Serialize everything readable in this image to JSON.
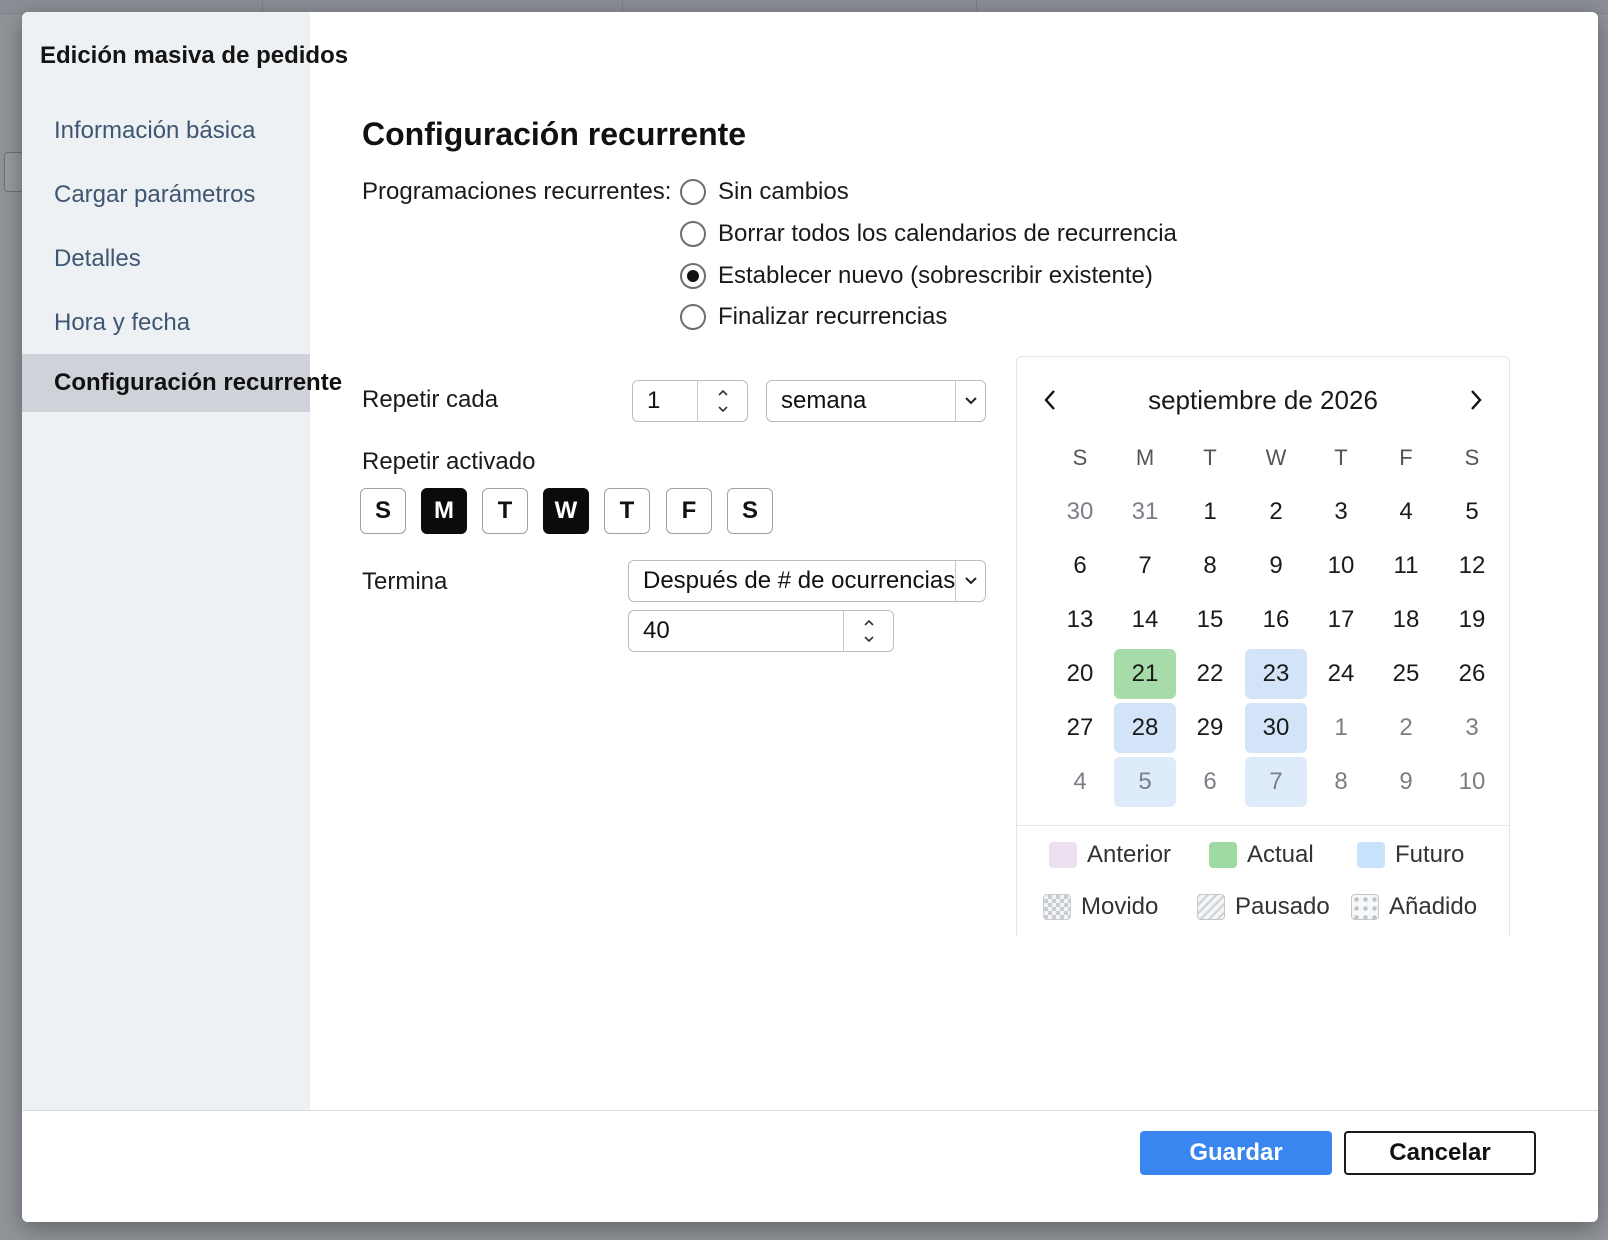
{
  "modal": {
    "title": "Edición masiva de pedidos"
  },
  "sidebar": {
    "items": [
      {
        "label": "Información básica"
      },
      {
        "label": "Cargar parámetros"
      },
      {
        "label": "Detalles"
      },
      {
        "label": "Hora y fecha"
      },
      {
        "label": "Configuración recurrente",
        "active": true
      }
    ]
  },
  "main": {
    "section_title": "Configuración recurrente",
    "recurring_label": "Programaciones recurrentes:",
    "radio_options": [
      {
        "label": "Sin cambios",
        "checked": false
      },
      {
        "label": "Borrar todos los calendarios de recurrencia",
        "checked": false
      },
      {
        "label": "Establecer nuevo (sobrescribir existente)",
        "checked": true
      },
      {
        "label": "Finalizar recurrencias",
        "checked": false
      }
    ],
    "repeat_every_label": "Repetir cada",
    "repeat_every_value": "1",
    "repeat_unit_value": "semana",
    "repeat_on_label": "Repetir activado",
    "weekdays": [
      {
        "label": "S",
        "selected": false
      },
      {
        "label": "M",
        "selected": true
      },
      {
        "label": "T",
        "selected": false
      },
      {
        "label": "W",
        "selected": true
      },
      {
        "label": "T",
        "selected": false
      },
      {
        "label": "F",
        "selected": false
      },
      {
        "label": "S",
        "selected": false
      }
    ],
    "ends_label": "Termina",
    "ends_mode_value": "Después de # de ocurrencias",
    "occurrences_value": "40"
  },
  "calendar": {
    "month_label": "septiembre de 2026",
    "weekday_headers": [
      "S",
      "M",
      "T",
      "W",
      "T",
      "F",
      "S"
    ],
    "weeks": [
      [
        "30",
        "31",
        "1",
        "2",
        "3",
        "4",
        "5"
      ],
      [
        "6",
        "7",
        "8",
        "9",
        "10",
        "11",
        "12"
      ],
      [
        "13",
        "14",
        "15",
        "16",
        "17",
        "18",
        "19"
      ],
      [
        "20",
        "21",
        "22",
        "23",
        "24",
        "25",
        "26"
      ],
      [
        "27",
        "28",
        "29",
        "30",
        "1",
        "2",
        "3"
      ],
      [
        "4",
        "5",
        "6",
        "7",
        "8",
        "9",
        "10"
      ]
    ],
    "current_day": "21",
    "future_days": [
      "23",
      "28",
      "30",
      "5",
      "7"
    ],
    "legend": [
      {
        "label": "Anterior",
        "color": "#ecdff0",
        "icon": "solid-swatch"
      },
      {
        "label": "Actual",
        "color": "#9fdaa3",
        "icon": "solid-swatch"
      },
      {
        "label": "Futuro",
        "color": "#c9e2fb",
        "icon": "solid-swatch"
      },
      {
        "label": "Movido",
        "icon": "checker-swatch"
      },
      {
        "label": "Pausado",
        "icon": "hatched-swatch"
      },
      {
        "label": "Añadido",
        "icon": "dotted-swatch"
      }
    ]
  },
  "footer": {
    "save_label": "Guardar",
    "cancel_label": "Cancelar"
  },
  "colors": {
    "accent": "#3a86f0",
    "sidebar_bg": "#eef1f4",
    "sidebar_active_bg": "#cfd3d9",
    "current_day": "#a7dcaa",
    "future_day": "#d3e4f8"
  }
}
